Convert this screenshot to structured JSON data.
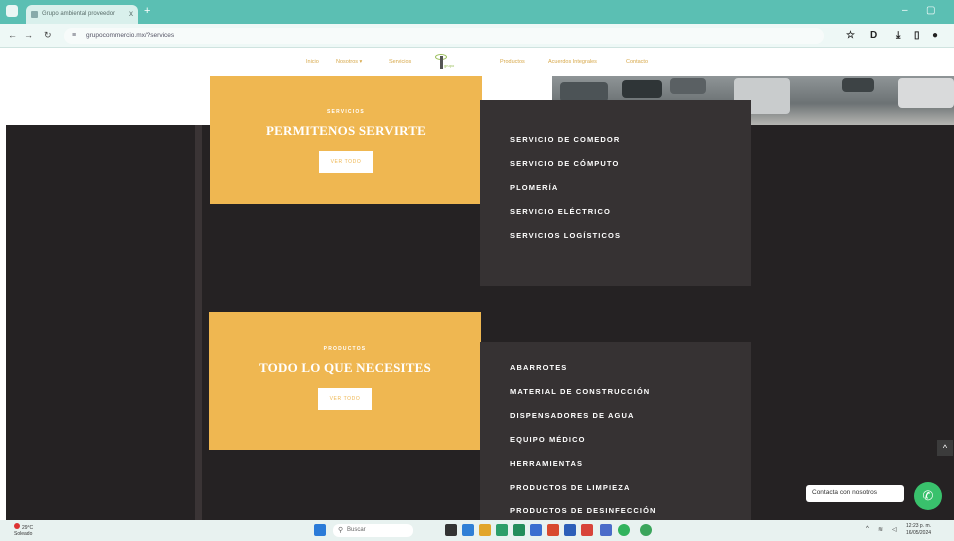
{
  "browser": {
    "tab_title": "Grupo ambiental proveedor",
    "tab_close": "x",
    "new_tab": "+",
    "minimize": "–",
    "maximize": "▢",
    "url": "grupocommercio.mx/?services"
  },
  "site_nav": {
    "items": [
      "Inicio",
      "Nosotros ▾",
      "Servicios",
      "Productos",
      "Acuerdos Integrales",
      "Contacto"
    ],
    "logo_text": "grupo"
  },
  "cards": [
    {
      "eyebrow": "SERVICIOS",
      "headline": "PERMITENOS SERVIRTE",
      "cta": "VER TODO"
    },
    {
      "eyebrow": "PRODUCTOS",
      "headline": "TODO LO QUE NECESITES",
      "cta": "VER TODO"
    }
  ],
  "services_list": [
    "SERVICIO DE COMEDOR",
    "SERVICIO DE CÓMPUTO",
    "PLOMERÍA",
    "SERVICIO ELÉCTRICO",
    "SERVICIOS LOGÍSTICOS"
  ],
  "products_list": [
    "ABARROTES",
    "MATERIAL DE CONSTRUCCIÓN",
    "DISPENSADORES DE AGUA",
    "EQUIPO MÉDICO",
    "HERRAMIENTAS",
    "PRODUCTOS DE LIMPIEZA",
    "PRODUCTOS DE DESINFECCIÓN"
  ],
  "chat": {
    "label": "Contacta con nosotros",
    "scroll_top": "^"
  },
  "taskbar": {
    "weather_temp": "29°C",
    "weather_desc": "Soleado",
    "search_placeholder": "Buscar",
    "time": "12:23 p. m.",
    "date": "16/05/2024"
  },
  "colors": {
    "accent": "#efb751",
    "dark_bg": "#252223",
    "panel_bg": "#363233",
    "browser_teal": "#5bbfb3",
    "whatsapp": "#39c16c"
  }
}
